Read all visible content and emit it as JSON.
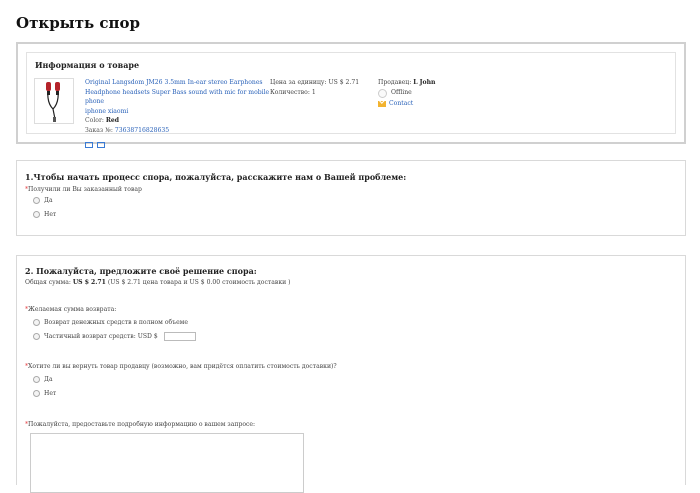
{
  "page": {
    "title": "Открыть спор"
  },
  "product": {
    "section_title": "Информация о товаре",
    "name_line1": "Original Langsdom JM26 3.5mm In-ear stereo Earphones",
    "name_line2": "Headphone headsets Super Bass sound with mic for mobile phone",
    "name_line3": "iphone xiaomi",
    "color_label": "Color:",
    "color_value": "Red",
    "order_label": "Заказ №:",
    "order_value": "73638716828635",
    "unit_price": "Цена за единицу: US $ 2.71",
    "quantity": "Количество: 1",
    "seller_label": "Продавец:",
    "seller_name": "L John",
    "status": "Offline",
    "contact": "Contact"
  },
  "question1": {
    "heading": "1.Чтобы начать процесс спора, пожалуйста, расскажите нам о Вашей проблеме:",
    "label": "Получили ли Вы заказанный товар",
    "options": [
      "Да",
      "Нет"
    ]
  },
  "question2": {
    "heading": "2. Пожалуйста, предложите своё решение спора:",
    "total_label": "Общая сумма:",
    "total_value": "US $ 2.71",
    "total_detail": "(US $ 2.71 цена товара и US $ 0.00 стоимость доставки )",
    "refund_label": "Желаемая сумма возврата:",
    "refund_options": [
      "Возврат денежных средств в полном объеме",
      "Частичный возврат средств: USD $"
    ],
    "return_label": "Хотите ли вы вернуть товар продавцу (возможно, вам придётся оплатить стоимость доставки)?",
    "return_options": [
      "Да",
      "Нет"
    ],
    "details_label": "Пожалуйста, предоставьте подробную информацию о вашем запросе:"
  },
  "colors": {
    "link": "#2a62b9",
    "required": "#e4393c",
    "border": "#d9d9d9"
  }
}
